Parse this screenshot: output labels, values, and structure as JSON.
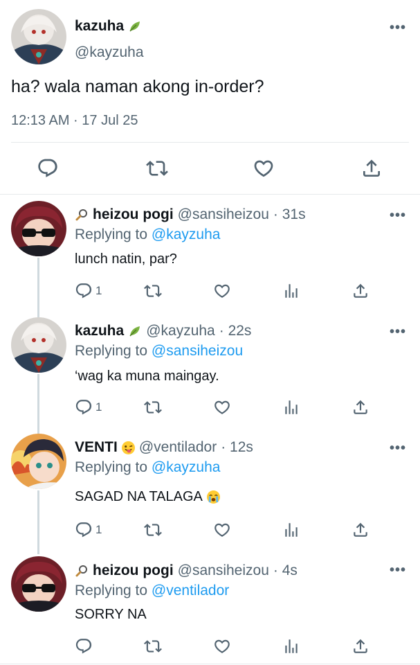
{
  "main_tweet": {
    "display_name": "kazuha",
    "name_badge": "leaf-emoji",
    "handle": "@kayzuha",
    "text": "ha? wala naman akong in-order?",
    "timestamp": "12:13 AM · 17 Jul 25",
    "actions": [
      "reply-icon",
      "retweet-icon",
      "like-icon",
      "share-icon"
    ]
  },
  "replies": [
    {
      "prefix_icon": "magnifier-emoji",
      "display_name": "heizou pogi",
      "handle": "@sansiheizou",
      "time": "· 31s",
      "replying_label": "Replying to",
      "replying_handle": "@kayzuha",
      "text": "lunch natin, par?",
      "reply_count": "1"
    },
    {
      "display_name": "kazuha",
      "name_badge": "leaf-emoji",
      "handle": "@kayzuha",
      "time": "· 22s",
      "replying_label": "Replying to",
      "replying_handle": "@sansiheizou",
      "text": "‘wag ka muna maingay.",
      "reply_count": "1"
    },
    {
      "display_name": "VENTI",
      "name_badge": "winking-tongue-emoji",
      "handle": "@ventilador",
      "time": "· 12s",
      "replying_label": "Replying to",
      "replying_handle": "@kayzuha",
      "text": "SAGAD NA TALAGA",
      "text_emoji": "loudly-crying-emoji",
      "reply_count": "1"
    },
    {
      "prefix_icon": "magnifier-emoji",
      "display_name": "heizou pogi",
      "handle": "@sansiheizou",
      "time": "· 4s",
      "replying_label": "Replying to",
      "replying_handle": "@ventilador",
      "text": "SORRY NA",
      "reply_count": ""
    }
  ],
  "more_glyph": "•••",
  "colors": {
    "link": "#1d9bf0",
    "secondary": "#536471",
    "divider": "#e6e9eb"
  }
}
